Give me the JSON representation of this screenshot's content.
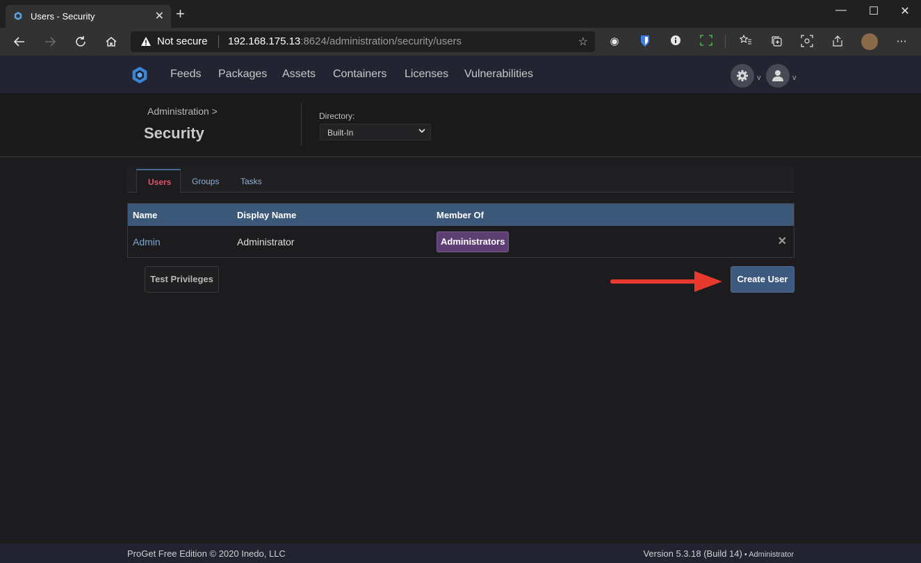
{
  "browser": {
    "tab_title": "Users - Security",
    "tab_close": "✕",
    "new_tab": "+",
    "window_minimize": "—",
    "window_maximize": "☐",
    "window_close": "✕",
    "security_label": "Not secure",
    "url_host": "192.168.175.13",
    "url_rest": ":8624/administration/security/users",
    "nav_icons": [
      "back-icon",
      "forward-icon",
      "refresh-icon",
      "home-icon"
    ]
  },
  "appnav": {
    "links": [
      "Feeds",
      "Packages",
      "Assets",
      "Containers",
      "Licenses",
      "Vulnerabilities"
    ],
    "settings_caret": "v",
    "user_caret": "v"
  },
  "header": {
    "breadcrumb": "Administration >",
    "title": "Security",
    "directory_label": "Directory:",
    "directory_value": "Built-In"
  },
  "tabs": [
    {
      "label": "Users",
      "active": true
    },
    {
      "label": "Groups",
      "active": false
    },
    {
      "label": "Tasks",
      "active": false
    }
  ],
  "table": {
    "columns": [
      "Name",
      "Display Name",
      "Member Of"
    ],
    "rows": [
      {
        "name": "Admin",
        "display_name": "Administrator",
        "member_of": "Administrators"
      }
    ],
    "delete_glyph": "✕"
  },
  "actions": {
    "test_privileges": "Test Privileges",
    "create_user": "Create User"
  },
  "footer": {
    "left": "ProGet Free Edition © 2020 Inedo, LLC",
    "version": "Version 5.3.18 (Build 14)",
    "separator": " • ",
    "user": "Administrator"
  },
  "colors": {
    "accent": "#3d5a7e",
    "active_tab": "#e0556b",
    "badge": "#5d3f73",
    "annotation_arrow": "#e8392f"
  }
}
